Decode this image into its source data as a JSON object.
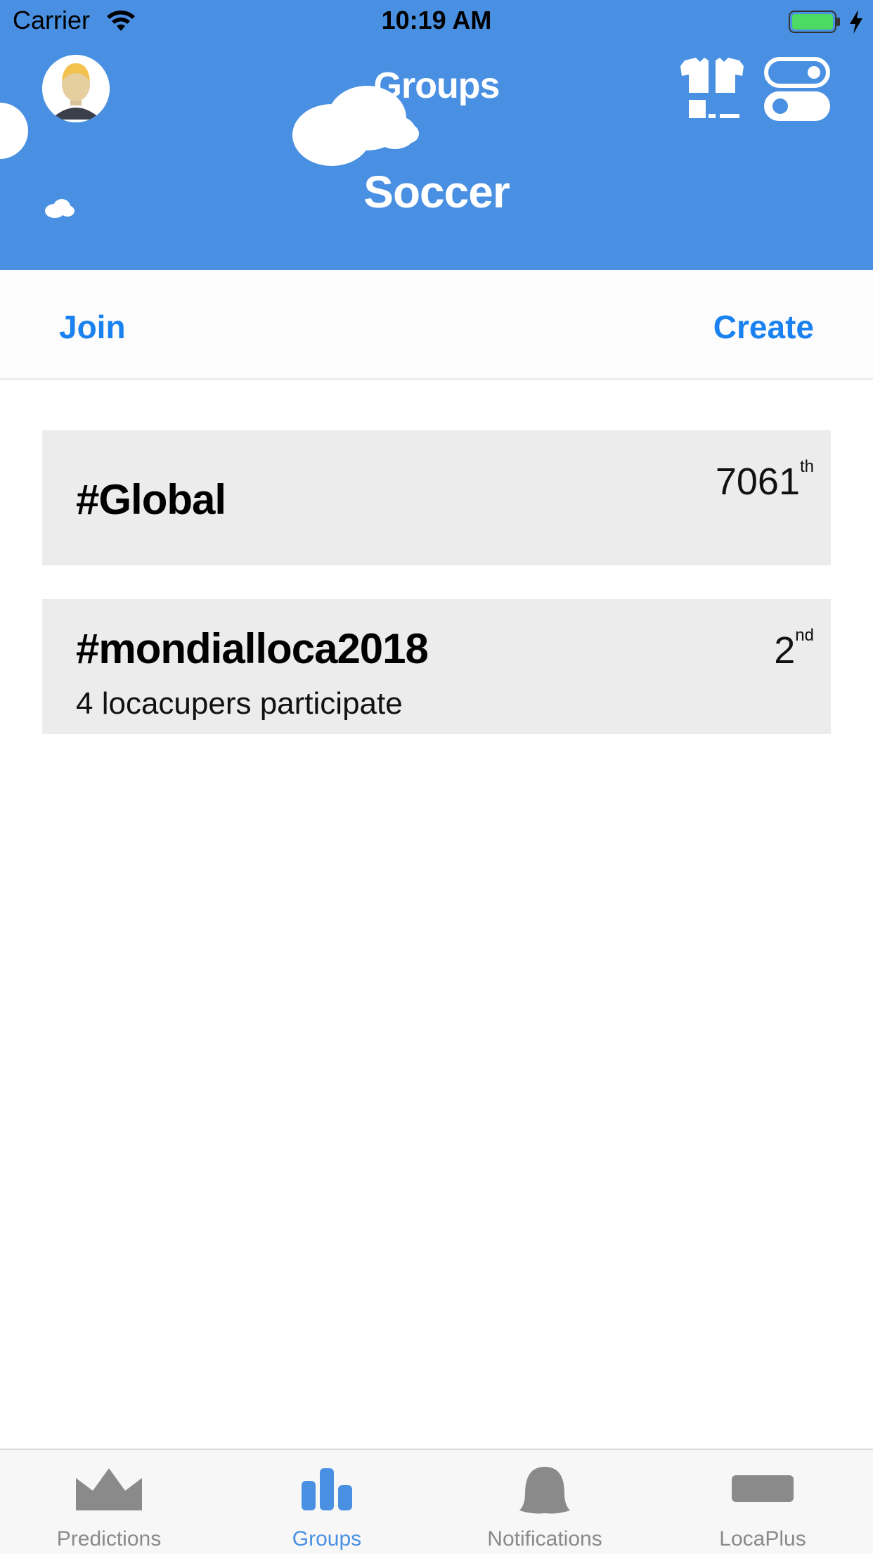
{
  "status_bar": {
    "carrier": "Carrier",
    "time": "10:19 AM"
  },
  "header": {
    "title": "Groups",
    "subtitle": "Soccer",
    "background_color": "#4a90e2"
  },
  "actions": {
    "join_label": "Join",
    "create_label": "Create",
    "accent_color": "#1a82f0"
  },
  "groups": [
    {
      "name": "#Global",
      "rank_number": "7061",
      "rank_suffix": "th",
      "subtitle": ""
    },
    {
      "name": "#mondialloca2018",
      "rank_number": "2",
      "rank_suffix": "nd",
      "subtitle": "4 locacupers participate"
    }
  ],
  "tab_bar": {
    "tabs": [
      {
        "label": "Predictions",
        "icon": "crown-icon",
        "active": false
      },
      {
        "label": "Groups",
        "icon": "bar-chart-icon",
        "active": true
      },
      {
        "label": "Notifications",
        "icon": "bell-icon",
        "active": false
      },
      {
        "label": "LocaPlus",
        "icon": "ticket-icon",
        "active": false
      }
    ],
    "active_color": "#4a90e2",
    "inactive_color": "#8a8a8a"
  }
}
